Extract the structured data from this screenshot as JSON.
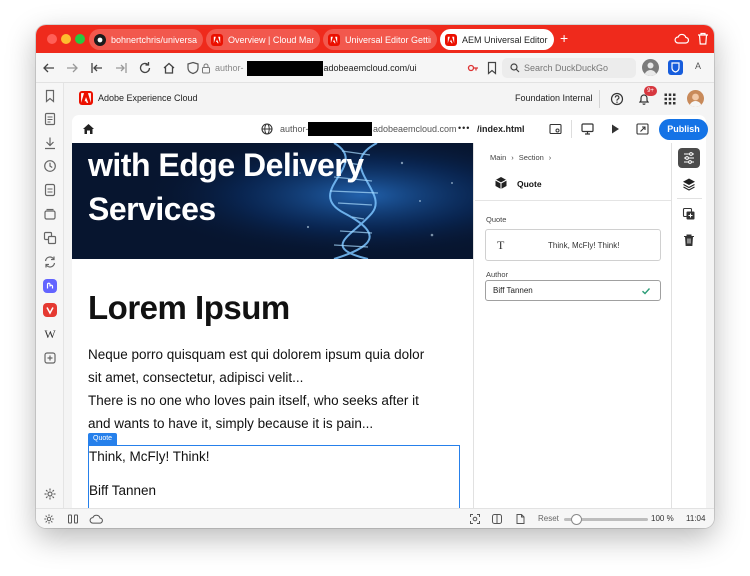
{
  "browser": {
    "tabs": [
      {
        "label": "bohnertchris/universal-ed",
        "favicon": "github-icon",
        "active": false
      },
      {
        "label": "Overview | Cloud Manager",
        "favicon": "adobe-icon",
        "active": false
      },
      {
        "label": "Universal Editor Getting St",
        "favicon": "adobe-icon",
        "active": false
      },
      {
        "label": "AEM Universal Editor | Ado",
        "favicon": "adobe-icon",
        "active": true
      }
    ],
    "new_tab": "+",
    "url_prefix": "author-",
    "url_host": "adobeaemcloud.com/ui",
    "search_placeholder": "Search DuckDuckGo",
    "profile_letter": "A"
  },
  "statusbar": {
    "reset_label": "Reset",
    "zoom": "100 %",
    "zoom_level": 0.1,
    "time": "11:04"
  },
  "adobe_shell": {
    "brand": "Adobe Experience Cloud",
    "org": "Foundation Internal",
    "notifications_badge": "9+"
  },
  "editor_toolbar": {
    "url_prefix": "author-",
    "url_host": "adobeaemcloud.com",
    "more": "•••",
    "path": "/index.html",
    "publish_label": "Publish"
  },
  "canvas": {
    "hero_lines": [
      "with Edge Delivery",
      "Services"
    ],
    "heading": "Lorem Ipsum",
    "paragraph_lines": [
      "Neque porro quisquam est qui dolorem ipsum quia dolor",
      "sit amet, consectetur, adipisci velit...",
      "There is no one who loves pain itself, who seeks after it",
      "and wants to have it, simply because it is pain..."
    ],
    "selection_label": "Quote",
    "quote_text": "Think, McFly! Think!",
    "quote_author": "Biff Tannen"
  },
  "properties": {
    "breadcrumb": [
      "Main",
      "Section"
    ],
    "component_name": "Quote",
    "quote_label": "Quote",
    "quote_value": "Think, McFly! Think!",
    "author_label": "Author",
    "author_value": "Biff Tannen"
  },
  "colors": {
    "browser_red": "#ef2a1c",
    "adobe_red": "#eb1000",
    "publish_blue": "#1473e6",
    "selection_blue": "#2680eb"
  }
}
